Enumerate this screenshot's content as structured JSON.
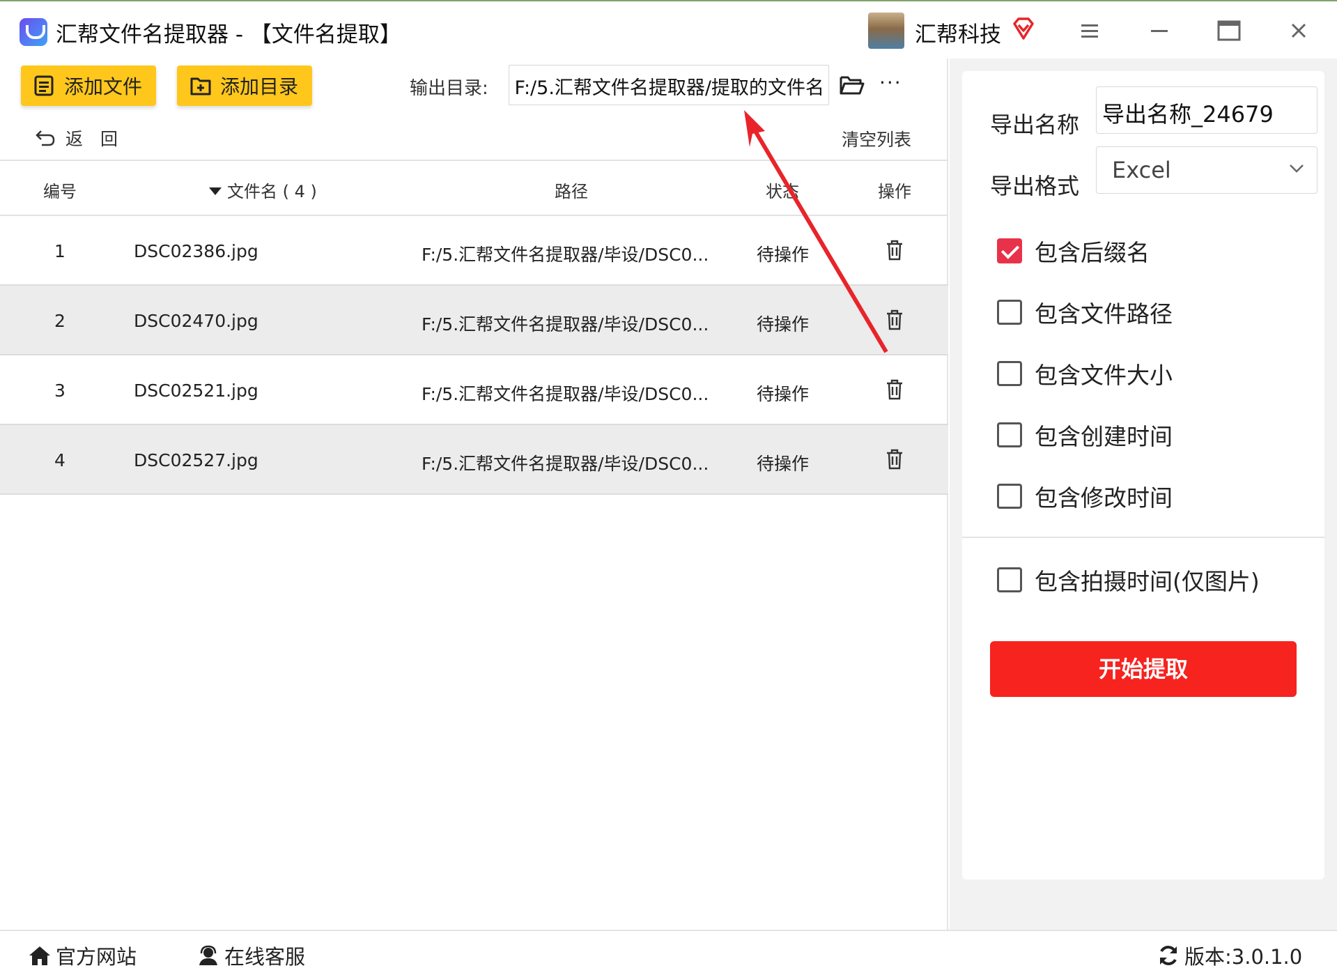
{
  "window": {
    "app_title": "汇帮文件名提取器 - 【文件名提取】",
    "company": "汇帮科技"
  },
  "toolbar": {
    "add_file": "添加文件",
    "add_dir": "添加目录",
    "output_label": "输出目录:",
    "output_path": "F:/5.汇帮文件名提取器/提取的文件名",
    "more": "···"
  },
  "list": {
    "back": "返　回",
    "clear": "清空列表",
    "headers": {
      "num": "编号",
      "name": "文件名 ( 4 )",
      "path": "路径",
      "status": "状态",
      "op": "操作"
    },
    "rows": [
      {
        "num": "1",
        "name": "DSC02386.jpg",
        "path": "F:/5.汇帮文件名提取器/毕设/DSC0...",
        "status": "待操作"
      },
      {
        "num": "2",
        "name": "DSC02470.jpg",
        "path": "F:/5.汇帮文件名提取器/毕设/DSC0...",
        "status": "待操作"
      },
      {
        "num": "3",
        "name": "DSC02521.jpg",
        "path": "F:/5.汇帮文件名提取器/毕设/DSC0...",
        "status": "待操作"
      },
      {
        "num": "4",
        "name": "DSC02527.jpg",
        "path": "F:/5.汇帮文件名提取器/毕设/DSC0...",
        "status": "待操作"
      }
    ]
  },
  "settings": {
    "name_label": "导出名称",
    "name_value": "导出名称_24679",
    "format_label": "导出格式",
    "format_value": "Excel",
    "options": [
      {
        "label": "包含后缀名",
        "checked": true
      },
      {
        "label": "包含文件路径",
        "checked": false
      },
      {
        "label": "包含文件大小",
        "checked": false
      },
      {
        "label": "包含创建时间",
        "checked": false
      },
      {
        "label": "包含修改时间",
        "checked": false
      },
      {
        "label": "包含拍摄时间(仅图片)",
        "checked": false
      }
    ],
    "start": "开始提取"
  },
  "footer": {
    "site": "官方网站",
    "service": "在线客服",
    "version": "版本:3.0.1.0"
  },
  "colors": {
    "yellow": "#ffc71c",
    "red_button": "#f6231f",
    "check": "#e8324a",
    "arrow": "#e8242a"
  }
}
